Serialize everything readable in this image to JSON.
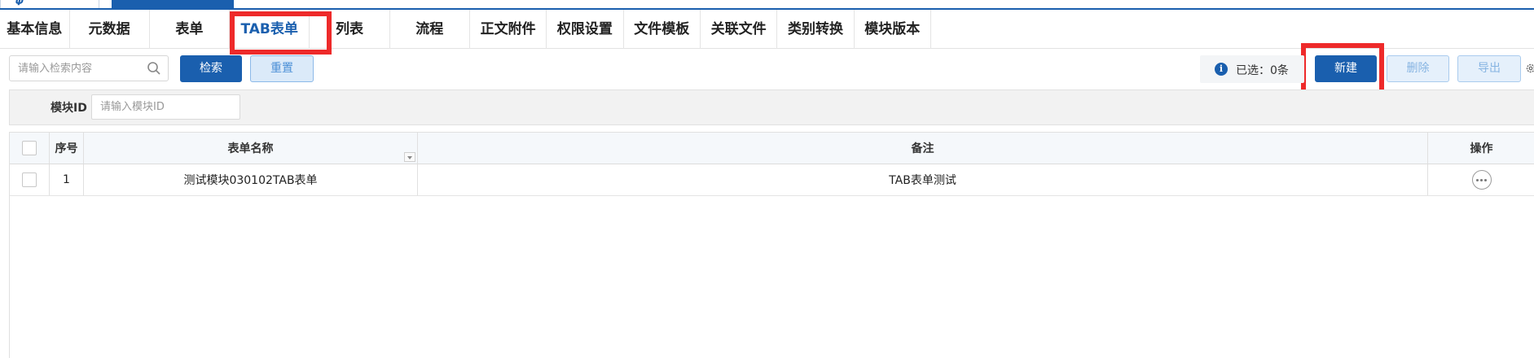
{
  "tabs": [
    {
      "label": "基本信息",
      "active": false
    },
    {
      "label": "元数据",
      "active": false
    },
    {
      "label": "表单",
      "active": false
    },
    {
      "label": "TAB表单",
      "active": true
    },
    {
      "label": "列表",
      "active": false
    },
    {
      "label": "流程",
      "active": false
    },
    {
      "label": "正文附件",
      "active": false
    },
    {
      "label": "权限设置",
      "active": false
    },
    {
      "label": "文件模板",
      "active": false
    },
    {
      "label": "关联文件",
      "active": false
    },
    {
      "label": "类别转换",
      "active": false
    },
    {
      "label": "模块版本",
      "active": false
    }
  ],
  "toolbar": {
    "search_placeholder": "请输入检索内容",
    "search_label": "检索",
    "reset_label": "重置",
    "selected_text": "已选：0条",
    "new_label": "新建",
    "delete_label": "删除",
    "export_label": "导出"
  },
  "filter": {
    "module_id_label": "模块ID",
    "module_id_placeholder": "请输入模块ID"
  },
  "table": {
    "columns": [
      "序号",
      "表单名称",
      "备注",
      "操作"
    ],
    "rows": [
      {
        "index": "1",
        "name": "测试模块030102TAB表单",
        "note": "TAB表单测试"
      }
    ]
  },
  "colors": {
    "primary": "#1a5fae",
    "highlight": "#ee2a2a"
  }
}
